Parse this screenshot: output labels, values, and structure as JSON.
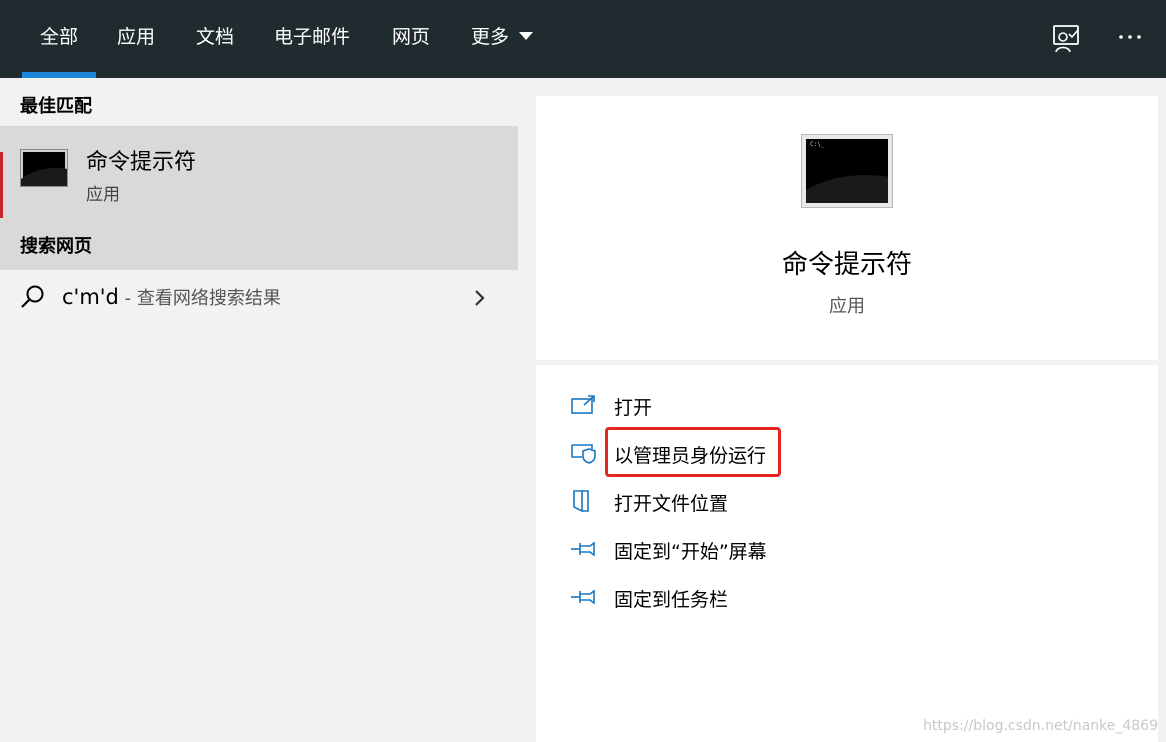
{
  "tabs": [
    {
      "label": "全部",
      "active": true
    },
    {
      "label": "应用"
    },
    {
      "label": "文档"
    },
    {
      "label": "电子邮件"
    },
    {
      "label": "网页"
    },
    {
      "label": "更多"
    }
  ],
  "top_icons": [
    "feedback-icon",
    "more-options-icon"
  ],
  "left": {
    "best_match_heading": "最佳匹配",
    "best_match": {
      "title": "命令提示符",
      "subtitle": "应用",
      "icon": "cmd-app-icon"
    },
    "web_heading": "搜索网页",
    "web_result": {
      "query": "c'm'd",
      "hint": " - 查看网络搜索结果"
    }
  },
  "right": {
    "app_title": "命令提示符",
    "app_subtitle": "应用",
    "prompt_text": "C:\\_",
    "actions": [
      {
        "label": "打开",
        "icon": "open-icon"
      },
      {
        "label": "以管理员身份运行",
        "icon": "shield-admin-icon"
      },
      {
        "label": "打开文件位置",
        "icon": "file-location-icon"
      },
      {
        "label": "固定到“开始”屏幕",
        "icon": "pin-start-icon"
      },
      {
        "label": "固定到任务栏",
        "icon": "pin-taskbar-icon"
      }
    ]
  },
  "watermark": "https://blog.csdn.net/nanke_4869",
  "colors": {
    "topbar": "#1f2b2f",
    "accent": "#1a86d9",
    "highlight": "#e3261f",
    "icon_blue": "#1a78c2"
  }
}
